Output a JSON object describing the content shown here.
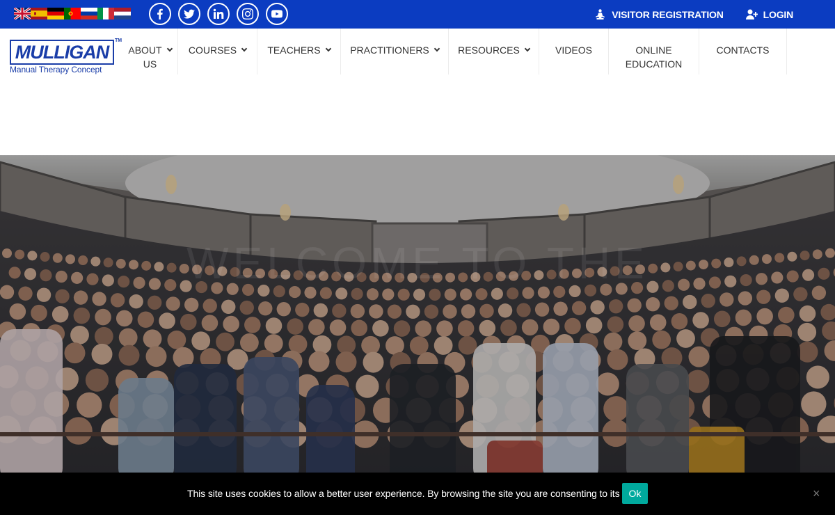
{
  "topbar": {
    "flags": [
      {
        "name": "english-flag-icon",
        "colors": [
          "#012169",
          "#ffffff",
          "#c8102e"
        ]
      },
      {
        "name": "spanish-flag-icon",
        "colors": [
          "#aa151b",
          "#f1bf00"
        ]
      },
      {
        "name": "german-flag-icon",
        "colors": [
          "#000000",
          "#dd0000",
          "#ffce00"
        ]
      },
      {
        "name": "portuguese-flag-icon",
        "colors": [
          "#006600",
          "#ff0000"
        ]
      },
      {
        "name": "russian-flag-icon",
        "colors": [
          "#ffffff",
          "#0039a6",
          "#d52b1e"
        ]
      },
      {
        "name": "italian-flag-icon",
        "colors": [
          "#009246",
          "#ffffff",
          "#ce2b37"
        ]
      },
      {
        "name": "dutch-flag-icon",
        "colors": [
          "#ae1c28",
          "#ffffff",
          "#21468b"
        ]
      }
    ],
    "socials": [
      "facebook-icon",
      "twitter-icon",
      "linkedin-icon",
      "instagram-icon",
      "youtube-icon"
    ],
    "visitor_registration": "VISITOR REGISTRATION",
    "login": "LOGIN",
    "background": "#0b3cc1"
  },
  "logo": {
    "word": "MULLIGAN",
    "tm": "TM",
    "subtitle": "Manual Therapy Concept"
  },
  "nav": {
    "items": [
      {
        "line1": "ABOUT",
        "line2": "US",
        "dropdown": true
      },
      {
        "line1": "COURSES",
        "line2": "",
        "dropdown": true
      },
      {
        "line1": "TEACHERS",
        "line2": "",
        "dropdown": true
      },
      {
        "line1": "PRACTITIONERS",
        "line2": "",
        "dropdown": true
      },
      {
        "line1": "RESOURCES",
        "line2": "",
        "dropdown": true
      },
      {
        "line1": "VIDEOS",
        "line2": "",
        "dropdown": false
      },
      {
        "line1": "ONLINE",
        "line2": "EDUCATION",
        "dropdown": false
      },
      {
        "line1": "CONTACTS",
        "line2": "",
        "dropdown": false
      }
    ]
  },
  "hero": {
    "faded_text": "WELCOME TO THE"
  },
  "cookie": {
    "text": "This site uses cookies to allow a better user experience. By browsing the site you are consenting to its use.",
    "ok": "Ok",
    "close": "×",
    "button_color": "#00a99d"
  }
}
